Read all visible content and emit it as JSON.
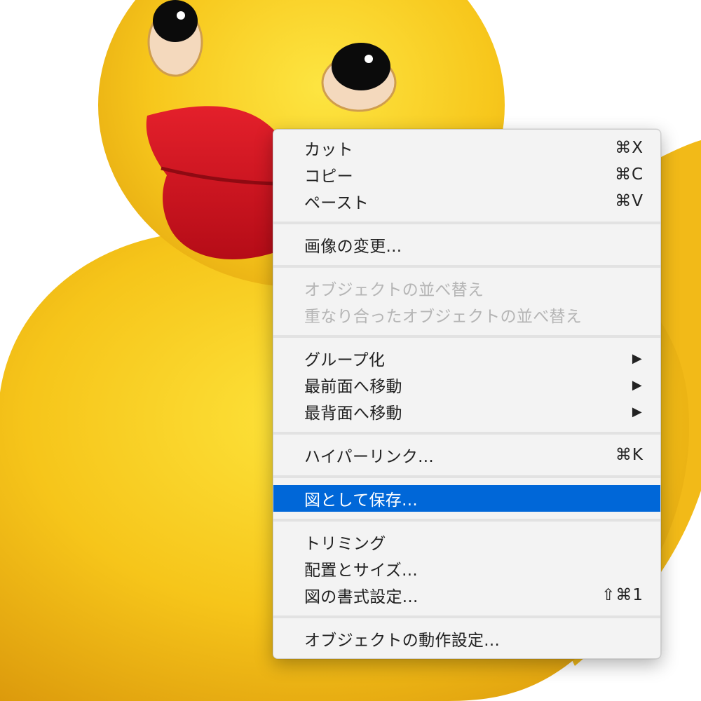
{
  "colors": {
    "menu_background": "#f3f3f3",
    "highlight": "#0067d8",
    "disabled_text": "#b5b5b5",
    "duck_yellow": "#f6c51a",
    "beak_red": "#d4101c"
  },
  "background": {
    "subject": "rubber-duck"
  },
  "menu": {
    "groups": [
      [
        {
          "label": "カット",
          "shortcut": "⌘X"
        },
        {
          "label": "コピー",
          "shortcut": "⌘C"
        },
        {
          "label": "ペースト",
          "shortcut": "⌘V"
        }
      ],
      [
        {
          "label": "画像の変更..."
        }
      ],
      [
        {
          "label": "オブジェクトの並べ替え",
          "disabled": true
        },
        {
          "label": "重なり合ったオブジェクトの並べ替え",
          "disabled": true
        }
      ],
      [
        {
          "label": "グループ化",
          "submenu_icon": "▶"
        },
        {
          "label": "最前面へ移動",
          "submenu_icon": "▶"
        },
        {
          "label": "最背面へ移動",
          "submenu_icon": "▶"
        }
      ],
      [
        {
          "label": "ハイパーリンク...",
          "shortcut": "⌘K"
        }
      ],
      [
        {
          "label": "図として保存...",
          "highlighted": true
        }
      ],
      [
        {
          "label": "トリミング"
        },
        {
          "label": "配置とサイズ..."
        },
        {
          "label": "図の書式設定...",
          "shortcut": "⇧⌘1"
        }
      ],
      [
        {
          "label": "オブジェクトの動作設定..."
        }
      ]
    ]
  }
}
